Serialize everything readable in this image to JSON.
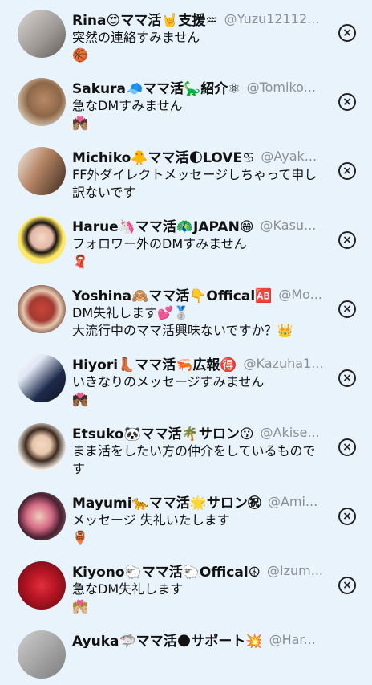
{
  "contacts": [
    {
      "name": "Rina😍ママ活🤘支援♒",
      "handle": "@Yuzu12112...",
      "msg": "突然の連絡すみません",
      "extra": "🏀",
      "bg": "linear-gradient(135deg,#d9d7d4,#9b9591 60%,#5f5a57)"
    },
    {
      "name": "Sakura🧢ママ活🦕紹介⚛",
      "handle": "@Tomiko...",
      "msg": "急なDMすみません",
      "extra": "💏🏽",
      "bg": "radial-gradient(circle at 55% 45%,#b78a67 0,#8e6648 45%,#c9b79f 70%,#e7e2da)"
    },
    {
      "name": "Michiko🐥ママ活🌓LOVE♋",
      "handle": "@Ayak...",
      "msg": "FF外ダイレクトメッセージしちゃって申し訳ないです",
      "extra": "",
      "bg": "linear-gradient(120deg,#f2ede4,#b38363 45%,#3d2a1f)"
    },
    {
      "name": "Harue🦄ママ活🦚JAPAN😁",
      "handle": "@Kasu...",
      "msg": "フォロワー外のDMすみません",
      "extra": "🧣",
      "bg": "radial-gradient(circle at 50% 45%,#f6d8c8 0,#e2b7a4 30%,#1c1412 42%,#ffe95c 60%,#e6e6e6)"
    },
    {
      "name": "Yoshina🙈ママ活👇Offical🆎",
      "handle": "@Mo...",
      "msg": "DM失礼します💕🥈",
      "extra": "大流行中のママ活興味ないですか？👑",
      "bg": "radial-gradient(circle at 50% 50%,#c9443a 0,#a33a30 35%,#e4c7b0 55%,#6b3a2a 80%)"
    },
    {
      "name": "Hiyori👢ママ活🦐広報🉐",
      "handle": "@Kazuha1...",
      "msg": "いきなりのメッセージすみません",
      "extra": "💏🏾",
      "bg": "linear-gradient(135deg,#ffffff 0,#dfe6f3 30%,#1e2a4a 65%,#0f1526)"
    },
    {
      "name": "Etsuko🐼ママ活🌴サロン😗",
      "handle": "@Akise...",
      "msg": "まま活をしたい方の仲介をしているものです",
      "extra": "",
      "bg": "radial-gradient(circle at 50% 45%,#f3d9c4 0,#e8c8ad 25%,#3d2a1f 45%,#f7f2ec 70%)"
    },
    {
      "name": "Mayumi🐆ママ活🌟サロン㊗",
      "handle": "@Ami...",
      "msg": "メッセージ 失礼いたします",
      "extra": "🏺",
      "bg": "radial-gradient(circle at 45% 50%,#f1cdb9 0,#d46a85 35%,#4a2030 60%,#8a8076)"
    },
    {
      "name": "Kiyono🐑ママ活🐑Offical☮",
      "handle": "@Izum...",
      "msg": "急なDM失礼します",
      "extra": "💏🏼",
      "bg": "radial-gradient(circle,#e0303e 0,#b81524 40%,#7a0d18 80%)"
    },
    {
      "name": "Ayuka🦈ママ活🌑サポート💥",
      "handle": "@Har...",
      "msg": "",
      "extra": "",
      "bg": "linear-gradient(135deg,#cfcfcf,#7d7d7d)"
    }
  ],
  "close_glyph": "×"
}
